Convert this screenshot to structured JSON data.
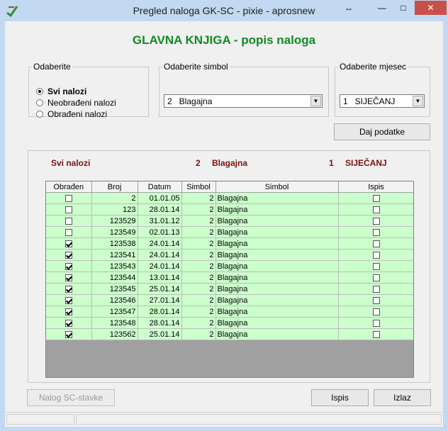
{
  "window": {
    "title": "Pregled naloga GK-SC - pixie - aprosnew",
    "resize_glyph": "↔",
    "minimize_glyph": "—",
    "maximize_glyph": "□",
    "close_glyph": "✕"
  },
  "heading": "GLAVNA KNJIGA - popis naloga",
  "filter_group": {
    "legend": "Odaberite",
    "options": [
      {
        "label": "Svi nalozi",
        "selected": true
      },
      {
        "label": "Neobrađeni nalozi",
        "selected": false
      },
      {
        "label": "Obrađeni nalozi",
        "selected": false
      }
    ]
  },
  "symbol_group": {
    "legend": "Odaberite simbol",
    "value": "2   Blagajna"
  },
  "month_group": {
    "legend": "Odaberite mjesec",
    "value": "1   SIJEČANJ"
  },
  "buttons": {
    "get_data": "Daj podatke",
    "nalog_sc": "Nalog SC-stavke",
    "print": "Ispis",
    "exit": "Izlaz"
  },
  "summary": {
    "filter": "Svi nalozi",
    "symbol_no": "2",
    "symbol_name": "Blagajna",
    "month_no": "1",
    "month_name": "SIJEČANJ"
  },
  "table": {
    "columns": [
      "Obrađen",
      "Broj",
      "Datum",
      "Simbol",
      "Simbol",
      "Ispis"
    ],
    "rows": [
      {
        "obraden": false,
        "broj": "2",
        "datum": "01.01.05",
        "simbol": "2",
        "naziv": "Blagajna",
        "ispis": false
      },
      {
        "obraden": false,
        "broj": "123",
        "datum": "28.01.14",
        "simbol": "2",
        "naziv": "Blagajna",
        "ispis": false
      },
      {
        "obraden": false,
        "broj": "123529",
        "datum": "31.01.12",
        "simbol": "2",
        "naziv": "Blagajna",
        "ispis": false
      },
      {
        "obraden": false,
        "broj": "123549",
        "datum": "02.01.13",
        "simbol": "2",
        "naziv": "Blagajna",
        "ispis": false
      },
      {
        "obraden": true,
        "broj": "123538",
        "datum": "24.01.14",
        "simbol": "2",
        "naziv": "Blagajna",
        "ispis": false
      },
      {
        "obraden": true,
        "broj": "123541",
        "datum": "24.01.14",
        "simbol": "2",
        "naziv": "Blagajna",
        "ispis": false
      },
      {
        "obraden": true,
        "broj": "123543",
        "datum": "24.01.14",
        "simbol": "2",
        "naziv": "Blagajna",
        "ispis": false
      },
      {
        "obraden": true,
        "broj": "123544",
        "datum": "13.01.14",
        "simbol": "2",
        "naziv": "Blagajna",
        "ispis": false
      },
      {
        "obraden": true,
        "broj": "123545",
        "datum": "25.01.14",
        "simbol": "2",
        "naziv": "Blagajna",
        "ispis": false
      },
      {
        "obraden": true,
        "broj": "123546",
        "datum": "27.01.14",
        "simbol": "2",
        "naziv": "Blagajna",
        "ispis": false
      },
      {
        "obraden": true,
        "broj": "123547",
        "datum": "28.01.14",
        "simbol": "2",
        "naziv": "Blagajna",
        "ispis": false
      },
      {
        "obraden": true,
        "broj": "123548",
        "datum": "28.01.14",
        "simbol": "2",
        "naziv": "Blagajna",
        "ispis": false
      },
      {
        "obraden": true,
        "broj": "123562",
        "datum": "25.01.14",
        "simbol": "2",
        "naziv": "Blagajna",
        "ispis": false
      }
    ]
  },
  "colors": {
    "heading": "#118a22",
    "summary_text": "#7a1010",
    "row_background": "#ccffcc",
    "window_frame": "#c2d9f1"
  }
}
